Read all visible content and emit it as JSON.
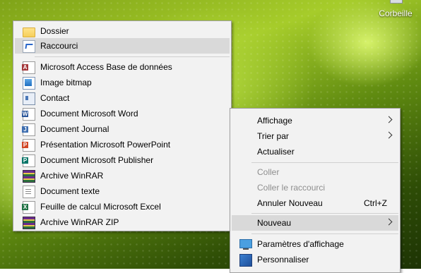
{
  "desktop": {
    "recycle_bin_label": "Corbeille"
  },
  "new_submenu": {
    "items": [
      {
        "label": "Dossier",
        "icon": "folder-icon"
      },
      {
        "label": "Raccourci",
        "icon": "shortcut-icon"
      },
      {
        "label": "Microsoft Access Base de données",
        "icon": "access-icon"
      },
      {
        "label": "Image bitmap",
        "icon": "bitmap-icon"
      },
      {
        "label": "Contact",
        "icon": "contact-icon"
      },
      {
        "label": "Document Microsoft Word",
        "icon": "word-icon"
      },
      {
        "label": "Document Journal",
        "icon": "journal-icon"
      },
      {
        "label": "Présentation Microsoft PowerPoint",
        "icon": "powerpoint-icon"
      },
      {
        "label": "Document Microsoft Publisher",
        "icon": "publisher-icon"
      },
      {
        "label": "Archive WinRAR",
        "icon": "winrar-icon"
      },
      {
        "label": "Document texte",
        "icon": "text-document-icon"
      },
      {
        "label": "Feuille de calcul Microsoft Excel",
        "icon": "excel-icon"
      },
      {
        "label": "Archive WinRAR ZIP",
        "icon": "winrar-zip-icon"
      }
    ]
  },
  "context_menu": {
    "view": "Affichage",
    "sort_by": "Trier par",
    "refresh": "Actualiser",
    "paste": "Coller",
    "paste_shortcut": "Coller le raccourci",
    "undo_new": "Annuler Nouveau",
    "undo_shortcut": "Ctrl+Z",
    "new": "Nouveau",
    "display_settings": "Paramètres d'affichage",
    "personalize": "Personnaliser"
  },
  "colors": {
    "menu_bg": "#f2f2f2",
    "hover_bg": "#d9d9d9",
    "disabled_text": "#8e8e8e",
    "word": "#2b579a",
    "excel": "#217346",
    "powerpoint": "#d24726",
    "access": "#a4373a",
    "publisher": "#077568"
  }
}
